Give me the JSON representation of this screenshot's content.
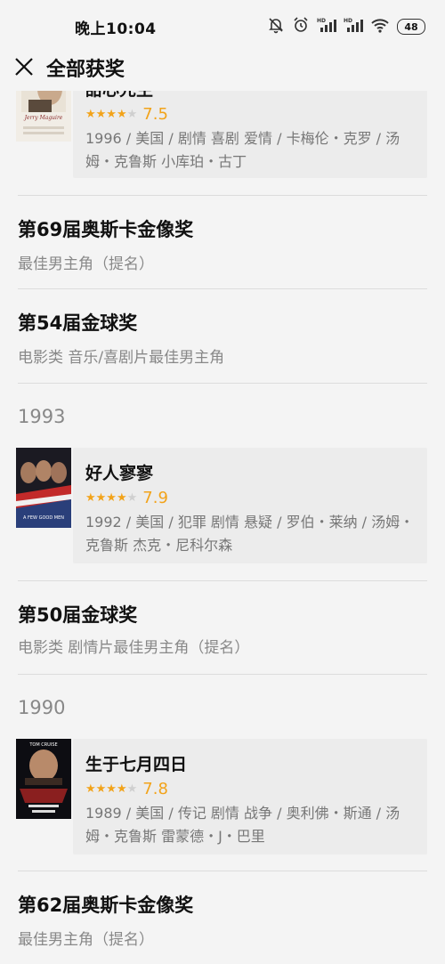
{
  "status": {
    "time": "晚上10:04",
    "battery": "48",
    "hd1": "HD",
    "hd2": "HD"
  },
  "nav": {
    "title": "全部获奖"
  },
  "films": [
    {
      "title": "甜心先生",
      "score": "7.5",
      "stars": 4,
      "meta": "1996 / 美国 / 剧情 喜剧 爱情 / 卡梅伦・克罗 / 汤姆・克鲁斯 小库珀・古丁",
      "poster_text": "Jerry Maguire"
    },
    {
      "title": "好人寥寥",
      "score": "7.9",
      "stars": 4,
      "meta": "1992 / 美国 / 犯罪 剧情 悬疑 / 罗伯・莱纳 / 汤姆・克鲁斯 杰克・尼科尔森",
      "poster_text": "A FEW GOOD MEN"
    },
    {
      "title": "生于七月四日",
      "score": "7.8",
      "stars": 4,
      "meta": "1989 / 美国 / 传记 剧情 战争 / 奥利佛・斯通 / 汤姆・克鲁斯 雷蒙德・J・巴里",
      "poster_text": "TOM CRUISE"
    }
  ],
  "awards": [
    {
      "title": "第69届奥斯卡金像奖",
      "sub": "最佳男主角（提名）"
    },
    {
      "title": "第54届金球奖",
      "sub": "电影类 音乐/喜剧片最佳男主角"
    },
    {
      "title": "第50届金球奖",
      "sub": "电影类 剧情片最佳男主角（提名）"
    },
    {
      "title": "第62届奥斯卡金像奖",
      "sub": "最佳男主角（提名）"
    }
  ],
  "years": [
    "1993",
    "1990"
  ]
}
